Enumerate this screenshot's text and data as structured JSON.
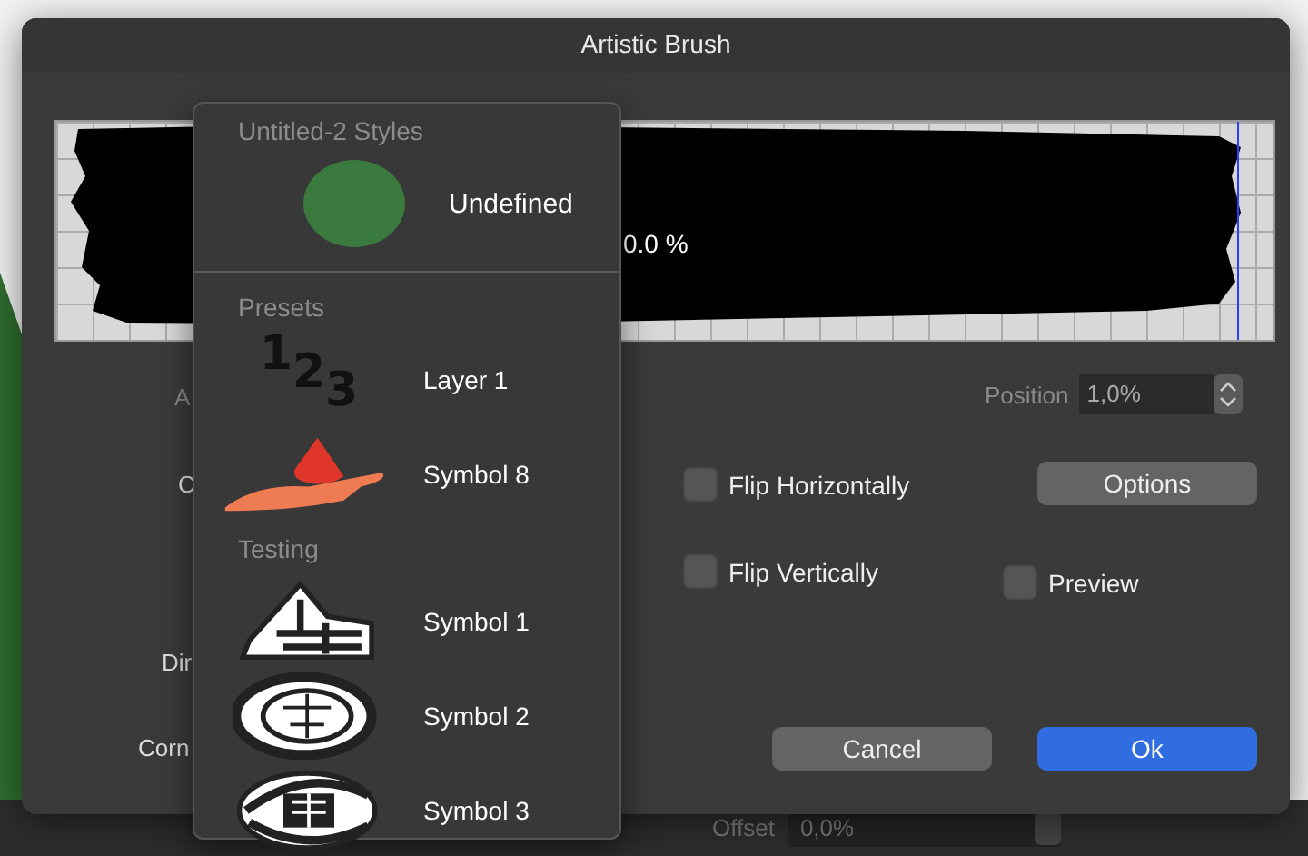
{
  "window": {
    "title": "Artistic Brush"
  },
  "preview": {
    "reading": "0.0 %"
  },
  "labels": [
    "A",
    "C",
    "Dir",
    "Corn"
  ],
  "position": {
    "label": "Position",
    "value": "1,0%"
  },
  "checkboxes": [
    {
      "label": "Flip Horizontally",
      "checked": false
    },
    {
      "label": "Flip Vertically",
      "checked": false
    },
    {
      "label": "Preview",
      "checked": false
    }
  ],
  "buttons": [
    {
      "label": "Options",
      "kind": "plain"
    },
    {
      "label": "Cancel",
      "kind": "plain"
    },
    {
      "label": "Ok",
      "kind": "default"
    }
  ],
  "menu": {
    "sections": [
      {
        "title": "Untitled-2 Styles",
        "items": [
          {
            "label": "Undefined",
            "kind": "swatch",
            "color": "#3b7a3e"
          }
        ]
      },
      {
        "title": "Presets",
        "items": [
          {
            "label": "Layer 1",
            "kind": "digits",
            "glyphs": "123"
          },
          {
            "label": "Symbol 8",
            "kind": "hand"
          }
        ]
      },
      {
        "title": "Testing",
        "items": [
          {
            "label": "Symbol 1",
            "kind": "triangle"
          },
          {
            "label": "Symbol 2",
            "kind": "circle"
          },
          {
            "label": "Symbol 3",
            "kind": "ellipse"
          }
        ]
      }
    ]
  },
  "background": {
    "offset": {
      "label": "Offset",
      "value": "0,0%"
    }
  }
}
